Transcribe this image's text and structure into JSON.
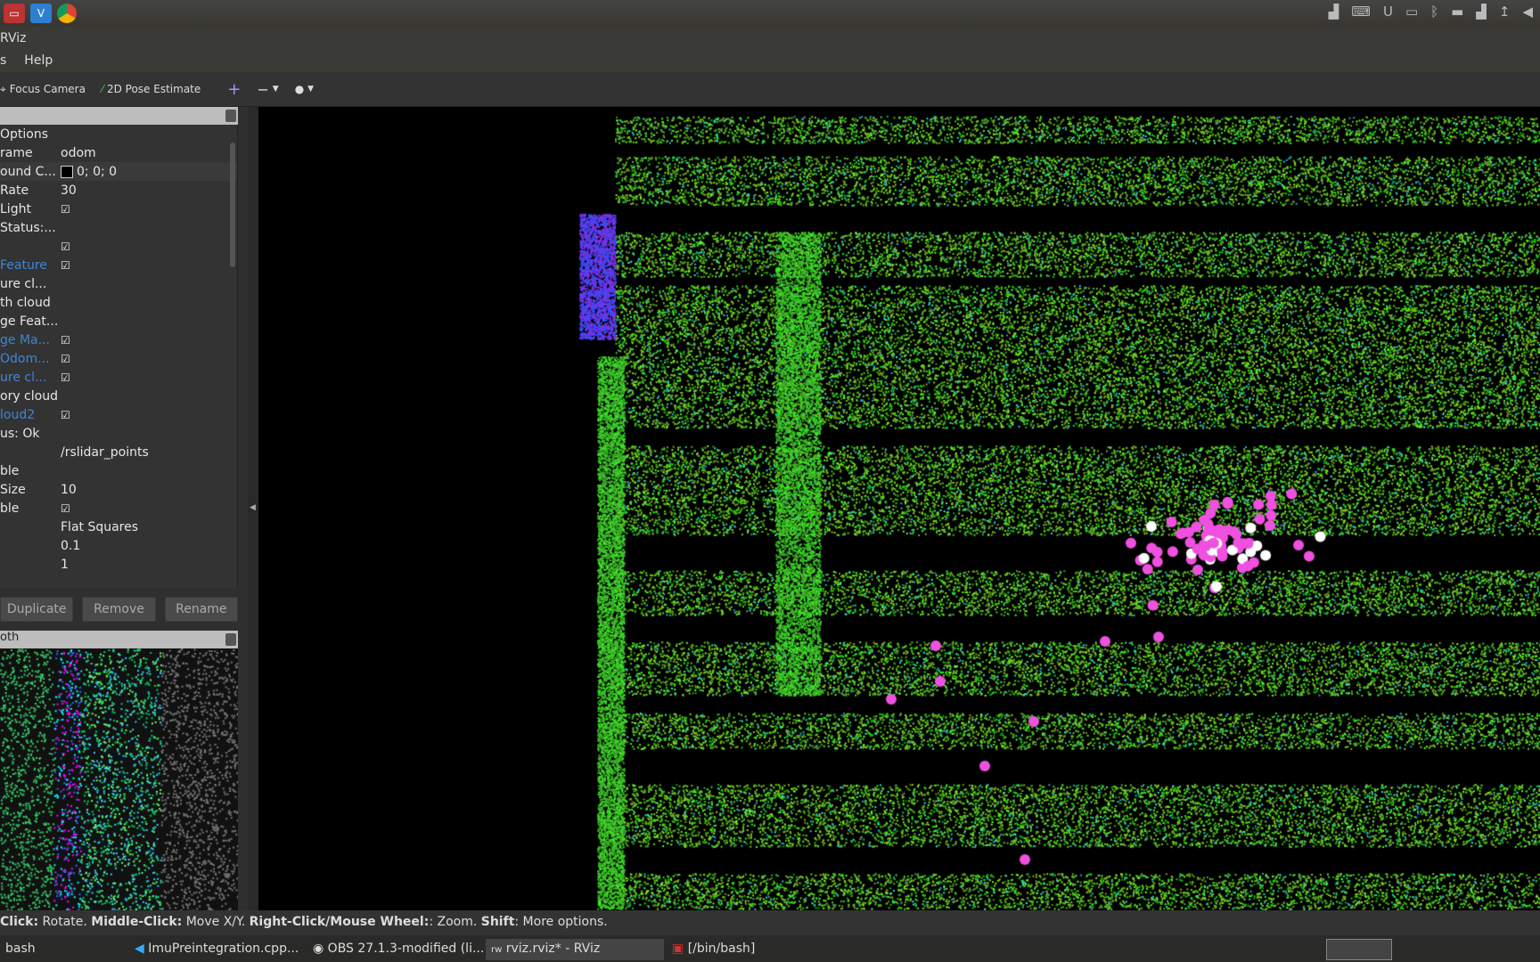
{
  "topbar": {
    "launcher_icons": [
      "terminal-icon",
      "vscode-icon",
      "chrome-icon"
    ],
    "tray_icons": [
      "network-icon",
      "keyboard-icon",
      "power-icon",
      "display-icon",
      "bluetooth-icon",
      "battery-icon",
      "signal-icon",
      "upload-icon",
      "volume-icon"
    ]
  },
  "window": {
    "title": "RViz"
  },
  "menu": [
    "s",
    "Help"
  ],
  "toolbar": {
    "focus_camera": "Focus Camera",
    "pose_estimate": "2D Pose Estimate",
    "add": "+",
    "remove": "−",
    "view": "👁"
  },
  "displays": {
    "rows": [
      {
        "key": "Options",
        "value": ""
      },
      {
        "key": "rame",
        "value": "odom"
      },
      {
        "key": "ound C...",
        "value": "0; 0; 0",
        "swatch": "#000000"
      },
      {
        "key": "Rate",
        "value": "30"
      },
      {
        "key": " Light",
        "check": true
      },
      {
        "key": "Status:...",
        "value": ""
      },
      {
        "key": "",
        "check": true
      },
      {
        "key": "Feature",
        "check": true,
        "blue": true
      },
      {
        "key": "ure cl...",
        "value": ""
      },
      {
        "key": "th cloud",
        "value": ""
      },
      {
        "key": "ge Feat...",
        "value": ""
      },
      {
        "key": "ge Ma...",
        "check": true,
        "blue": true
      },
      {
        "key": "Odom...",
        "check": true,
        "blue": true
      },
      {
        "key": "ure cl...",
        "check": true,
        "blue": true
      },
      {
        "key": "ory cloud",
        "value": ""
      },
      {
        "key": "loud2",
        "check": true,
        "blue": true
      },
      {
        "key": "us: Ok",
        "value": ""
      },
      {
        "key": "",
        "value": "/rslidar_points"
      },
      {
        "key": "ble",
        "value": ""
      },
      {
        "key": "Size",
        "value": "10"
      },
      {
        "key": "ble",
        "check": true
      },
      {
        "key": "",
        "value": "Flat Squares"
      },
      {
        "key": "",
        "value": "0.1"
      },
      {
        "key": "",
        "value": "1"
      }
    ],
    "buttons": {
      "duplicate": "Duplicate",
      "remove": "Remove",
      "rename": "Rename"
    }
  },
  "image_panel": {
    "title": "oth"
  },
  "status": [
    {
      "b": true,
      "t": "Click:"
    },
    {
      "b": false,
      "t": " Rotate. "
    },
    {
      "b": true,
      "t": "Middle-Click:"
    },
    {
      "b": false,
      "t": " Move X/Y. "
    },
    {
      "b": true,
      "t": "Right-Click/Mouse Wheel:"
    },
    {
      "b": false,
      "t": ": Zoom. "
    },
    {
      "b": true,
      "t": "Shift"
    },
    {
      "b": false,
      "t": ": More options."
    }
  ],
  "taskbar": {
    "items": [
      "bash",
      "ImuPreintegration.cpp...",
      "OBS 27.1.3-modified (li...",
      "rviz.rviz* - RViz",
      "[/bin/bash]"
    ]
  }
}
